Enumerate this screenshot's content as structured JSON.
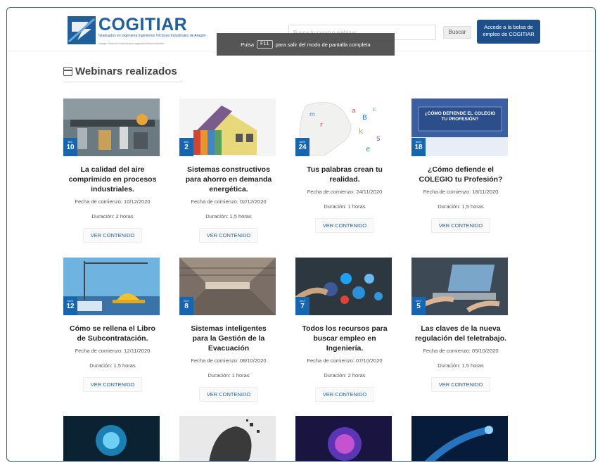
{
  "header": {
    "logo_name": "COGITIAR",
    "logo_sub": "Graduados en Ingeniería Ingenieros Técnicos Industriales de Aragón",
    "logo_sub2": "Colegio Oficial de Graduados en Ingeniería Rama Industrial",
    "search_placeholder": "Busca tu curso o webinar",
    "search_button": "Buscar",
    "job_button": "Accede a la bolsa de empleo de COGITIAR"
  },
  "fullscreen_notice": {
    "prefix": "Pulsa",
    "key": "F11",
    "suffix": "para salir del modo de pantalla completa"
  },
  "section": {
    "title": "Webinars realizados"
  },
  "cards": [
    {
      "month": "DIC",
      "day": "10",
      "title": "La calidad del aire comprimido en procesos industriales.",
      "date": "Fecha de comienzo: 10/12/2020",
      "duration": "Duración: 2 horas",
      "button": "VER CONTENIDO"
    },
    {
      "month": "DIC",
      "day": "2",
      "title": "Sistemas constructivos para ahorro en demanda energética.",
      "date": "Fecha de comienzo: 02/12/2020",
      "duration": "Duración: 1,5 horas",
      "button": "VER CONTENIDO"
    },
    {
      "month": "NOV",
      "day": "24",
      "title": "Tus palabras crean tu realidad.",
      "date": "Fecha de comienzo: 24/11/2020",
      "duration": "Duración: 1 horas",
      "button": "VER CONTENIDO"
    },
    {
      "month": "NOV",
      "day": "18",
      "title": "¿Cómo defiende el COLEGIO tu Profesión?",
      "date": "Fecha de comienzo: 18/11/2020",
      "duration": "Duración: 1,5 horas",
      "button": "VER CONTENIDO",
      "thumb_text": "¿CÓMO DEFIENDE EL COLEGIO TU PROFESIÓN?"
    },
    {
      "month": "NOV",
      "day": "12",
      "title": "Cómo se rellena el Libro de Subcontratación.",
      "date": "Fecha de comienzo: 12/11/2020",
      "duration": "Duración: 1,5 horas",
      "button": "VER CONTENIDO"
    },
    {
      "month": "OCT",
      "day": "8",
      "title": "Sistemas inteligentes para la Gestión de la Evacuación",
      "date": "Fecha de comienzo: 08/10/2020",
      "duration": "Duración: 1 horas",
      "button": "VER CONTENIDO"
    },
    {
      "month": "OCT",
      "day": "7",
      "title": "Todos los recursos para buscar empleo en Ingeniería.",
      "date": "Fecha de comienzo: 07/10/2020",
      "duration": "Duración: 2 horas",
      "button": "VER CONTENIDO"
    },
    {
      "month": "OCT",
      "day": "5",
      "title": "Las claves de la nueva regulación del teletrabajo.",
      "date": "Fecha de comienzo: 05/10/2020",
      "duration": "Duración: 1,5 horas",
      "button": "VER CONTENIDO"
    }
  ],
  "colors": {
    "brand": "#1f5f9b",
    "badge": "#1565b0",
    "job_button": "#1f4f8b"
  }
}
